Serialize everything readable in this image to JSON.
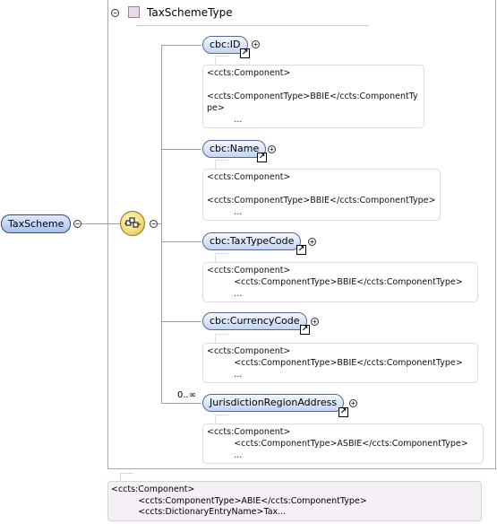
{
  "root": {
    "label": "TaxScheme"
  },
  "type": {
    "title": "TaxSchemeType"
  },
  "elements": [
    {
      "label": "cbc:ID",
      "annotation": "<ccts:Component>\n\n<ccts:ComponentType>BBIE</ccts:ComponentTy\npe>\n          ..."
    },
    {
      "label": "cbc:Name",
      "annotation": "<ccts:Component>\n\n<ccts:ComponentType>BBIE</ccts:ComponentType>\n          ..."
    },
    {
      "label": "cbc:TaxTypeCode",
      "annotation": "<ccts:Component>\n          <ccts:ComponentType>BBIE</ccts:ComponentType>\n          ..."
    },
    {
      "label": "cbc:CurrencyCode",
      "annotation": "<ccts:Component>\n          <ccts:ComponentType>BBIE</ccts:ComponentType>\n          ..."
    },
    {
      "label": "JurisdictionRegionAddress",
      "cardinality": "0..∞",
      "annotation": "<ccts:Component>\n          <ccts:ComponentType>ASBIE</ccts:ComponentType>\n          ..."
    }
  ],
  "bottom_annotation": "<ccts:Component>\n          <ccts:ComponentType>ABIE</ccts:ComponentType>\n          <ccts:DictionaryEntryName>Tax...",
  "symbols": {
    "collapse": "−",
    "expand": "+",
    "ref_arrow": "↗"
  }
}
